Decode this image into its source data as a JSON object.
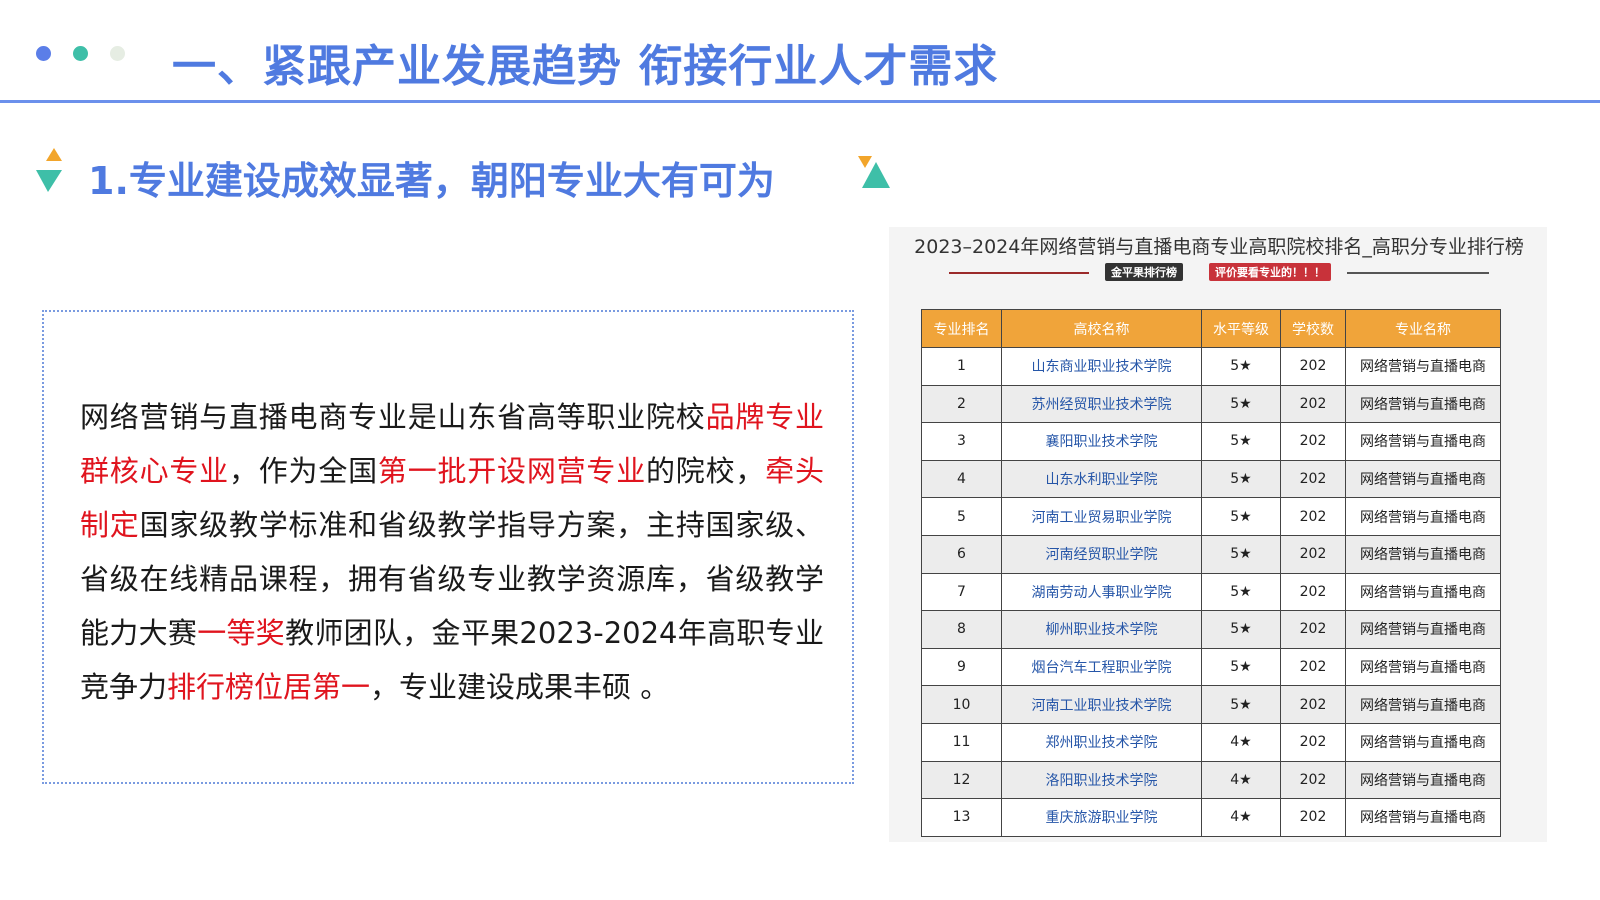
{
  "header": {
    "title": "一、紧跟产业发展趋势 衔接行业人才需求",
    "dot_colors": [
      "#5b7ee8",
      "#3ebfa8",
      "#e6ede3"
    ]
  },
  "subtitle": "1.专业建设成效显著，朝阳专业大有可为",
  "paragraph": {
    "segments": [
      {
        "text": "网络营销与直播电商专业是山东省高等职业院校",
        "highlight": false
      },
      {
        "text": "品牌专业群核心专业",
        "highlight": true
      },
      {
        "text": "，作为全国",
        "highlight": false
      },
      {
        "text": "第一批开设网营专业",
        "highlight": true
      },
      {
        "text": "的院校，",
        "highlight": false
      },
      {
        "text": "牵头制定",
        "highlight": true
      },
      {
        "text": "国家级教学标准和省级教学指导方案，主持国家级、省级在线精品课程，拥有省级专业教学资源库，省级教学能力大赛",
        "highlight": false
      },
      {
        "text": "一等奖",
        "highlight": true
      },
      {
        "text": "教师团队，金平果2023-2024年高职专业竞争力",
        "highlight": false
      },
      {
        "text": "排行榜位居第一",
        "highlight": true
      },
      {
        "text": "，专业建设成果丰硕 。",
        "highlight": false
      }
    ],
    "highlight_color": "#e0141e"
  },
  "ranking": {
    "title": "2023–2024年网络营销与直播电商专业高职院校排名_高职分专业排行榜",
    "badge_left": "金平果排行榜",
    "badge_right": "评价要看专业的！！！",
    "headers": [
      "专业排名",
      "高校名称",
      "水平等级",
      "学校数",
      "专业名称"
    ],
    "rows": [
      [
        "1",
        "山东商业职业技术学院",
        "5★",
        "202",
        "网络营销与直播电商"
      ],
      [
        "2",
        "苏州经贸职业技术学院",
        "5★",
        "202",
        "网络营销与直播电商"
      ],
      [
        "3",
        "襄阳职业技术学院",
        "5★",
        "202",
        "网络营销与直播电商"
      ],
      [
        "4",
        "山东水利职业学院",
        "5★",
        "202",
        "网络营销与直播电商"
      ],
      [
        "5",
        "河南工业贸易职业学院",
        "5★",
        "202",
        "网络营销与直播电商"
      ],
      [
        "6",
        "河南经贸职业学院",
        "5★",
        "202",
        "网络营销与直播电商"
      ],
      [
        "7",
        "湖南劳动人事职业学院",
        "5★",
        "202",
        "网络营销与直播电商"
      ],
      [
        "8",
        "柳州职业技术学院",
        "5★",
        "202",
        "网络营销与直播电商"
      ],
      [
        "9",
        "烟台汽车工程职业学院",
        "5★",
        "202",
        "网络营销与直播电商"
      ],
      [
        "10",
        "河南工业职业技术学院",
        "5★",
        "202",
        "网络营销与直播电商"
      ],
      [
        "11",
        "郑州职业技术学院",
        "4★",
        "202",
        "网络营销与直播电商"
      ],
      [
        "12",
        "洛阳职业技术学院",
        "4★",
        "202",
        "网络营销与直播电商"
      ],
      [
        "13",
        "重庆旅游职业学院",
        "4★",
        "202",
        "网络营销与直播电商"
      ]
    ]
  }
}
